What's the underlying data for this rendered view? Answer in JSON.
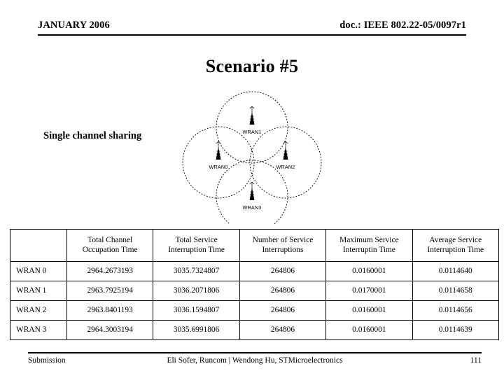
{
  "header": {
    "date": "JANUARY 2006",
    "doc": "doc.: IEEE 802.22-05/0097r1"
  },
  "title": "Scenario #5",
  "subtitle": "Single channel sharing",
  "diagram": {
    "name": "wran-coverage-diagram",
    "description": "Four overlapping dotted coverage circles each containing a base-station tower icon",
    "cells": [
      {
        "label": "WRAN1",
        "position": "top"
      },
      {
        "label": "WRAN0",
        "position": "left"
      },
      {
        "label": "WRAN2",
        "position": "right"
      },
      {
        "label": "WRAN3",
        "position": "bottom"
      }
    ]
  },
  "table": {
    "corner_header": "",
    "columns": [
      "Total Channel Occupation Time",
      "Total Service Interruption Time",
      "Number of Service Interruptions",
      "Maximum Service Interruptin Time",
      "Average Service Interruption Time"
    ],
    "columns_lines": [
      [
        "Total Channel",
        "Occupation Time"
      ],
      [
        "Total Service",
        "Interruption Time"
      ],
      [
        "Number of Service",
        "Interruptions"
      ],
      [
        "Maximum Service",
        "Interruptin Time"
      ],
      [
        "Average Service",
        "Interruption Time"
      ]
    ],
    "rows": [
      {
        "label": "WRAN 0",
        "total_channel_occupation_time": "2964.2673193",
        "total_service_interruption_time": "3035.7324807",
        "number_of_service_interruptions": "264806",
        "maximum_service_interruption_time": "0.0160001",
        "average_service_interruption_time": "0.0114640"
      },
      {
        "label": "WRAN 1",
        "total_channel_occupation_time": "2963.7925194",
        "total_service_interruption_time": "3036.2071806",
        "number_of_service_interruptions": "264806",
        "maximum_service_interruption_time": "0.0170001",
        "average_service_interruption_time": "0.0114658"
      },
      {
        "label": "WRAN 2",
        "total_channel_occupation_time": "2963.8401193",
        "total_service_interruption_time": "3036.1594807",
        "number_of_service_interruptions": "264806",
        "maximum_service_interruption_time": "0.0160001",
        "average_service_interruption_time": "0.0114656"
      },
      {
        "label": "WRAN 3",
        "label_alt": "WRAN 3",
        "total_channel_occupation_time": "2964.3003194",
        "total_service_interruption_time": "3035.6991806",
        "number_of_service_interruptions": "264806",
        "maximum_service_interruption_time": "0.0160001",
        "average_service_interruption_time": "0.0114639"
      }
    ]
  },
  "footer": {
    "left": "Submission",
    "center": "Eli Sofer, Runcom  |  Wendong Hu, STMicroelectronics",
    "page": "111"
  },
  "colors": {
    "text": "#000000",
    "background": "#ffffff",
    "rule": "#000000"
  }
}
